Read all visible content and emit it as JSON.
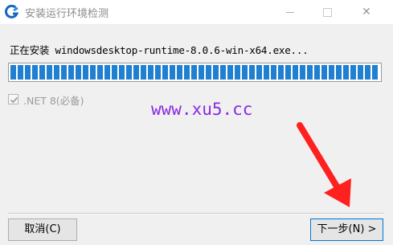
{
  "window": {
    "title": "安装运行环境检测",
    "icon": "app-logo-icon",
    "controls": {
      "minimize_icon": "minimize-icon",
      "maximize_icon": "maximize-icon",
      "close_label": "✕"
    }
  },
  "status": {
    "text": "正在安装 windowsdesktop-runtime-8.0.6-win-x64.exe..."
  },
  "progress": {
    "fraction": 1.0,
    "color": "#1f7fd0"
  },
  "components": [
    {
      "label": ".NET 8(必备)",
      "checked": true,
      "enabled": false
    }
  ],
  "watermark": {
    "text": "www.xu5.cc",
    "color": "#8a2be2"
  },
  "annotation": {
    "arrow_color": "#ff2020"
  },
  "buttons": {
    "cancel_label": "取消(C)",
    "next_label": "下一步(N) >"
  }
}
